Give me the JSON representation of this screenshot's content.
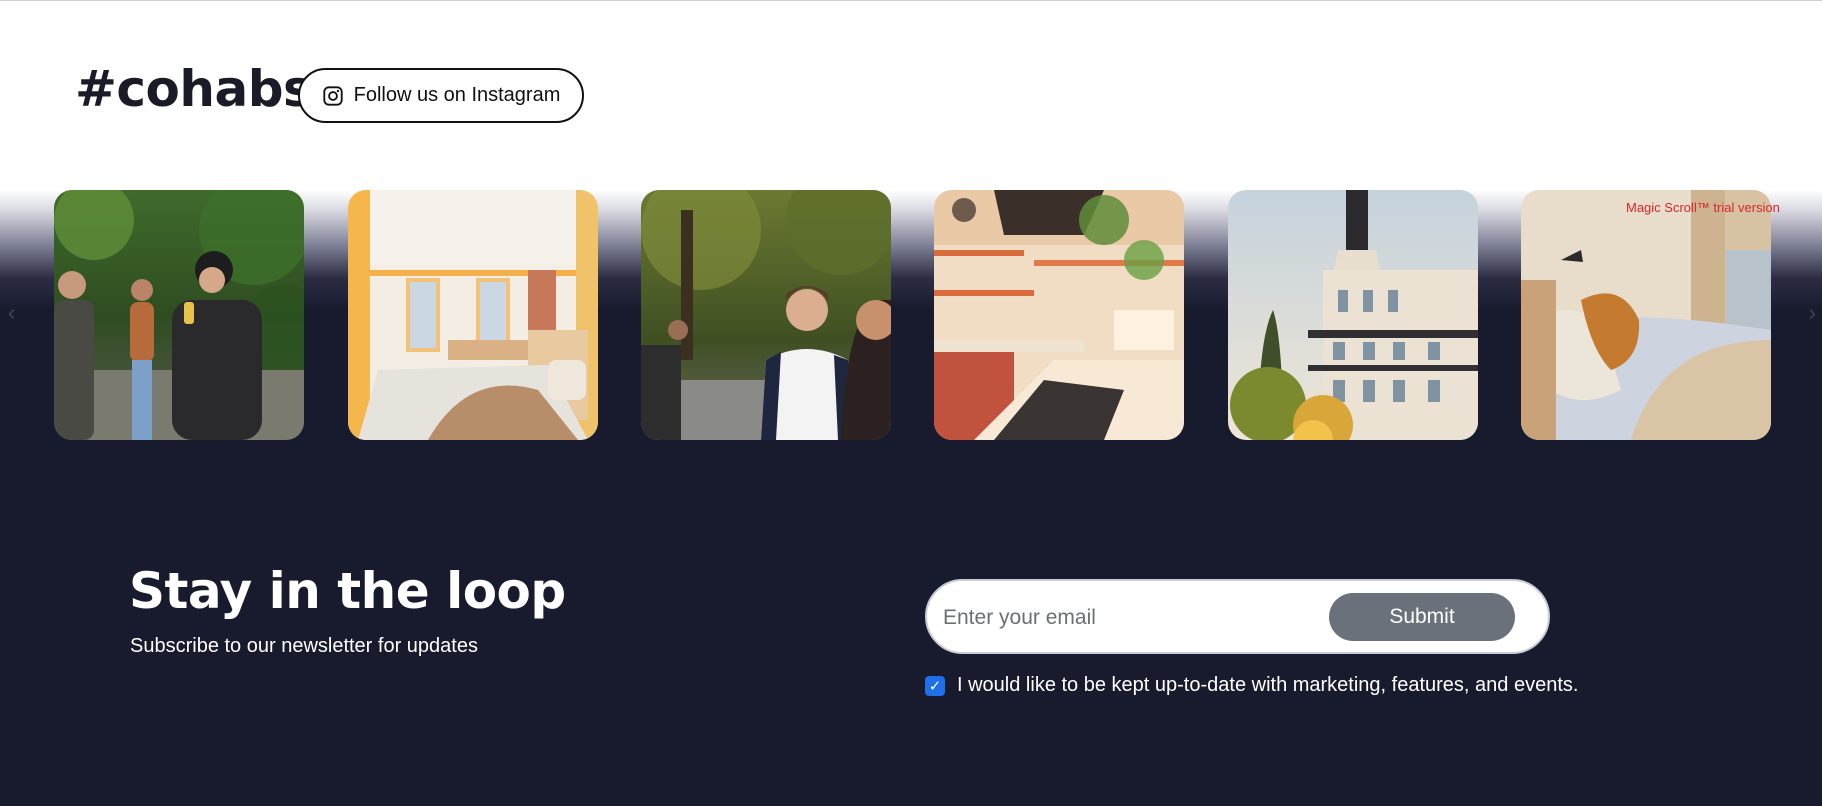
{
  "brand": {
    "hashtag": "#cohabs"
  },
  "instagram": {
    "label": "Follow us on Instagram",
    "icon": "instagram-icon"
  },
  "carousel": {
    "prev_icon": "‹",
    "next_icon": "›",
    "watermark": "Magic Scroll™ trial version",
    "photos": [
      {
        "name": "photo-garden-party",
        "subject": "people socializing in a garden"
      },
      {
        "name": "photo-bright-bedroom",
        "subject": "bright bedroom with bed and window"
      },
      {
        "name": "photo-smiling-man",
        "subject": "smiling man outdoors in a park"
      },
      {
        "name": "photo-kitchen",
        "subject": "modern kitchen with plants"
      },
      {
        "name": "photo-building",
        "subject": "ornate building with spire"
      },
      {
        "name": "photo-bed-closeup",
        "subject": "cozy bed with pillows"
      }
    ]
  },
  "newsletter": {
    "title": "Stay in the loop",
    "subtitle": "Subscribe to our newsletter for updates",
    "email_placeholder": "Enter your email",
    "submit_label": "Submit",
    "consent_label": "I would like to be kept up-to-date with marketing, features, and events.",
    "consent_checked": true
  },
  "colors": {
    "dark_band": "#181b2e",
    "submit_button": "#6b717a",
    "checkbox": "#1f6feb",
    "watermark": "#d8262b"
  }
}
